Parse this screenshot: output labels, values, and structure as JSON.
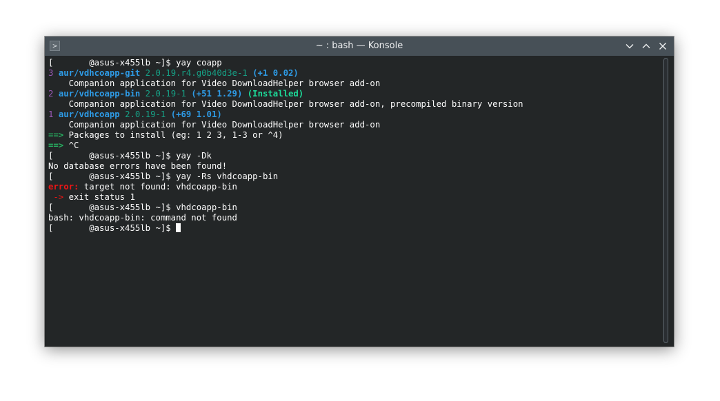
{
  "window": {
    "title": "~ : bash — Konsole",
    "app_icon_glyph": ">",
    "icons": {
      "app": "konsole-icon",
      "minimize": "chevron-down-icon",
      "maximize": "chevron-up-icon",
      "close": "close-icon"
    },
    "colors": {
      "titlebar": "#475057",
      "background": "#232627",
      "foreground": "#fcfcfc"
    }
  },
  "terminal": {
    "lines": [
      [
        {
          "t": "[       @asus-x455lb ~]$ yay coapp",
          "c": ""
        }
      ],
      [
        {
          "t": "3 ",
          "c": "c-purple"
        },
        {
          "t": "aur/",
          "c": "c-blue"
        },
        {
          "t": "vdhcoapp-git",
          "c": "c-blue"
        },
        {
          "t": " 2.0.19.r4.g0b40d3e-1 ",
          "c": "c-cyan"
        },
        {
          "t": "(+1 0.02)",
          "c": "c-bluebold"
        }
      ],
      [
        {
          "t": "    Companion application for Video DownloadHelper browser add-on",
          "c": ""
        }
      ],
      [
        {
          "t": "2 ",
          "c": "c-purple"
        },
        {
          "t": "aur/",
          "c": "c-blue"
        },
        {
          "t": "vdhcoapp-bin",
          "c": "c-blue"
        },
        {
          "t": " 2.0.19-1 ",
          "c": "c-cyan"
        },
        {
          "t": "(+51 1.29)",
          "c": "c-bluebold"
        },
        {
          "t": " (Installed)",
          "c": "c-green"
        }
      ],
      [
        {
          "t": "    Companion application for Video DownloadHelper browser add-on, precompiled binary version",
          "c": ""
        }
      ],
      [
        {
          "t": "1 ",
          "c": "c-purple"
        },
        {
          "t": "aur/",
          "c": "c-blue"
        },
        {
          "t": "vdhcoapp",
          "c": "c-blue"
        },
        {
          "t": " 2.0.19-1 ",
          "c": "c-cyan"
        },
        {
          "t": "(+69 1.01)",
          "c": "c-bluebold"
        }
      ],
      [
        {
          "t": "    Companion application for Video DownloadHelper browser add-on",
          "c": ""
        }
      ],
      [
        {
          "t": "==> ",
          "c": "c-arrow"
        },
        {
          "t": "Packages to install (eg: 1 2 3, 1-3 or ^4)",
          "c": ""
        }
      ],
      [
        {
          "t": "==> ",
          "c": "c-arrow"
        },
        {
          "t": "^C",
          "c": ""
        }
      ],
      [
        {
          "t": "[       @asus-x455lb ~]$ yay -Dk",
          "c": ""
        }
      ],
      [
        {
          "t": "No database errors have been found!",
          "c": ""
        }
      ],
      [
        {
          "t": "[       @asus-x455lb ~]$ yay -Rs vhdcoapp-bin",
          "c": ""
        }
      ],
      [
        {
          "t": "error:",
          "c": "c-red"
        },
        {
          "t": " target not found: vhdcoapp-bin",
          "c": ""
        }
      ],
      [
        {
          "t": " -> ",
          "c": "c-redarrow"
        },
        {
          "t": "exit status 1",
          "c": ""
        }
      ],
      [
        {
          "t": "[       @asus-x455lb ~]$ vhdcoapp-bin",
          "c": ""
        }
      ],
      [
        {
          "t": "bash: vhdcoapp-bin: command not found",
          "c": ""
        }
      ],
      [
        {
          "t": "[       @asus-x455lb ~]$ ",
          "c": ""
        }
      ]
    ]
  }
}
